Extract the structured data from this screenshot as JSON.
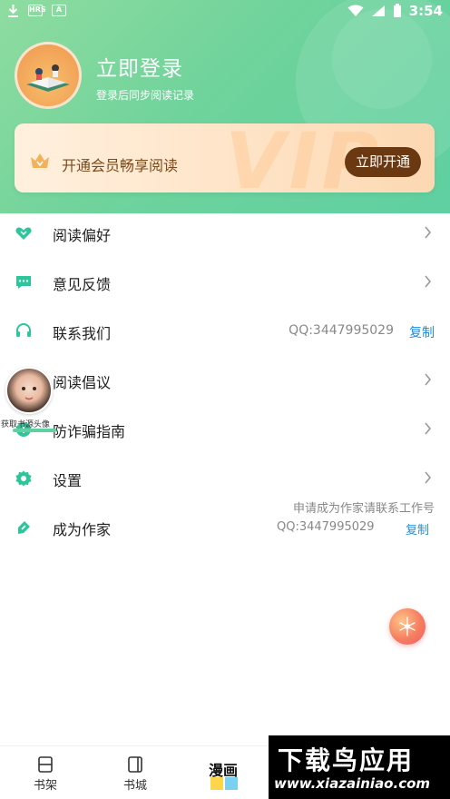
{
  "status_bar": {
    "time": "3:54",
    "icons": [
      "download-icon",
      "hrs-icon",
      "a-icon",
      "wifi-icon",
      "signal-icon",
      "battery-icon"
    ]
  },
  "profile": {
    "title": "立即登录",
    "subtitle": "登录后同步阅读记录"
  },
  "vip": {
    "watermark": "VIP",
    "text": "开通会员畅享阅读",
    "button": "立即开通",
    "button_color": "#6a3912"
  },
  "menu": {
    "items": [
      {
        "label": "阅读偏好",
        "icon": "heart-icon"
      },
      {
        "label": "意见反馈",
        "icon": "chat-bubble-icon"
      },
      {
        "label": "联系我们",
        "icon": "headset-icon",
        "value": "QQ:3447995029",
        "action": "复制"
      },
      {
        "label": "阅读倡议",
        "icon": "book-icon"
      },
      {
        "label": "防诈骗指南",
        "icon": "shield-plus-icon"
      },
      {
        "label": "设置",
        "icon": "gear-icon"
      },
      {
        "label": "成为作家",
        "icon": "pen-icon",
        "note": "申请成为作家请联系工作号",
        "value": "QQ:3447995029",
        "action": "复制"
      }
    ],
    "accent_color": "#2ec59a"
  },
  "float_widget": {
    "label": "获取书源头像"
  },
  "tabbar": {
    "tabs": [
      {
        "label": "书架",
        "icon": "bookshelf-icon"
      },
      {
        "label": "书城",
        "icon": "bookstore-icon"
      },
      {
        "label": "漫画",
        "icon": "manga-icon"
      }
    ]
  },
  "watermark": {
    "main": "下载鸟应用",
    "sub": "www.xiazainiao.com"
  }
}
